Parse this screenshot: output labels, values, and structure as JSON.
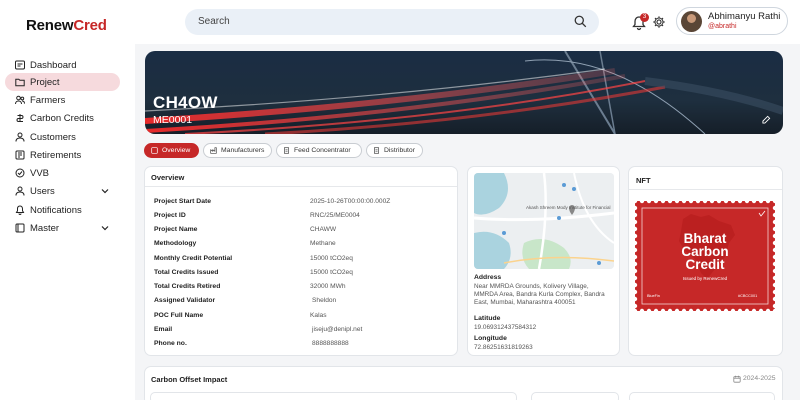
{
  "brand": {
    "logo_a": "Renew",
    "logo_b": "Cred"
  },
  "search": {
    "placeholder": "Search"
  },
  "notifications": {
    "count": "3"
  },
  "user": {
    "name": "Abhimanyu Rathi",
    "handle": "@abrathi"
  },
  "sidebar": {
    "items": [
      {
        "label": "Dashboard",
        "icon": "dashboard-icon"
      },
      {
        "label": "Project",
        "icon": "project-icon",
        "active": true
      },
      {
        "label": "Farmers",
        "icon": "farmers-icon"
      },
      {
        "label": "Carbon Credits",
        "icon": "carbon-credits-icon"
      },
      {
        "label": "Customers",
        "icon": "customers-icon"
      },
      {
        "label": "Retirements",
        "icon": "retirements-icon"
      },
      {
        "label": "VVB",
        "icon": "vvb-icon"
      },
      {
        "label": "Users",
        "icon": "users-icon",
        "expandable": true
      },
      {
        "label": "Notifications",
        "icon": "notifications-icon"
      },
      {
        "label": "Master",
        "icon": "master-icon",
        "expandable": true
      }
    ]
  },
  "project": {
    "title": "CH4OW",
    "code": "ME0001"
  },
  "tabs": [
    {
      "label": "Overview",
      "active": true
    },
    {
      "label": "Manufacturers"
    },
    {
      "label": "Feed Concentrator"
    },
    {
      "label": "Distributor"
    }
  ],
  "overview": {
    "title": "Overview",
    "rows": [
      {
        "label": "Project Start Date",
        "value": "2025-10-26T00:00:00.000Z"
      },
      {
        "label": "Project ID",
        "value": "RNC/25/ME0004"
      },
      {
        "label": "Project Name",
        "value": "CHAWW"
      },
      {
        "label": "Methodology",
        "value": "Methane"
      },
      {
        "label": "Monthly Credit Potential",
        "value": "15000 tCO2eq"
      },
      {
        "label": "Total Credits Issued",
        "value": "15000 tCO2eq"
      },
      {
        "label": "Total Credits Retired",
        "value": "32000 MWh"
      },
      {
        "label": "Assigned Validator",
        "value": "Sheldon"
      },
      {
        "label": "POC Full Name",
        "value": "Kalas"
      },
      {
        "label": "Email",
        "value": "jiseju@denipl.net"
      },
      {
        "label": "Phone no.",
        "value": "8888888888"
      }
    ]
  },
  "location": {
    "map_label": "Akash Shreem Mody Institute for Financial",
    "address_label": "Address",
    "address": "Near MMRDA Grounds, Kolivery Village, MMRDA Area, Bandra Kurla Complex, Bandra East, Mumbai, Maharashtra 400051",
    "latitude_label": "Latitude",
    "latitude": "19.069312437584312",
    "longitude_label": "Longitude",
    "longitude": "72.86251631819263"
  },
  "nft": {
    "title": "NFT",
    "line1": "Bharat",
    "line2": "Carbon",
    "line3": "Credit",
    "issued_by": "Issued by RenewCred",
    "footer_left": "BlueFin",
    "footer_right": "#CBCC001"
  },
  "impact": {
    "title": "Carbon Offset Impact",
    "year": "2024-2025"
  },
  "colors": {
    "accent": "#c62828",
    "active_bg": "#f6dadd",
    "main_bg": "#f4f5f7"
  }
}
